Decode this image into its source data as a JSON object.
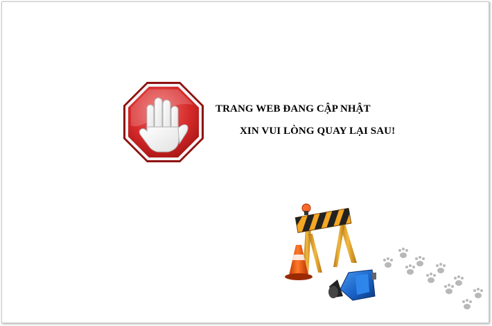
{
  "page": {
    "message_line1": "TRANG WEB ĐANG CẬP NHẬT",
    "message_line2": "XIN VUI LÒNG QUAY LẠI SAU!"
  },
  "icons": {
    "stop": "stop-hand-icon",
    "construction": "construction-barrier-icon",
    "footprints": "footprints-icon"
  },
  "colors": {
    "stop_red": "#d62a2a",
    "barrier_orange": "#f0a020",
    "cone_orange": "#ee5a10",
    "helmet_blue": "#1a63c9",
    "footprint_gray": "#b8b8b8"
  }
}
